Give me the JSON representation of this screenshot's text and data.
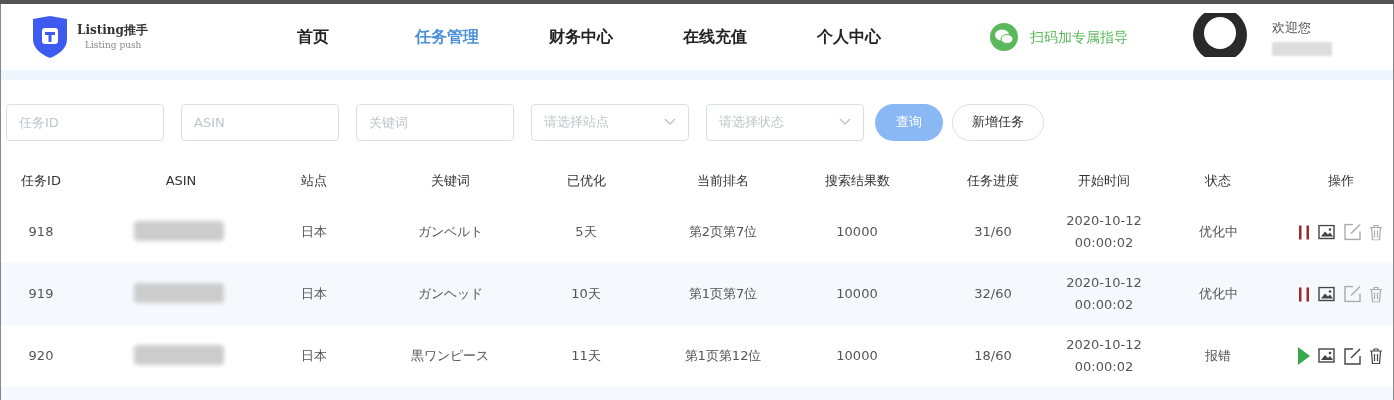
{
  "header": {
    "logo": {
      "title": "Listing推手",
      "subtitle": "Listing push"
    },
    "nav": [
      {
        "label": "首页",
        "selected": false
      },
      {
        "label": "任务管理",
        "selected": true
      },
      {
        "label": "财务中心",
        "selected": false
      },
      {
        "label": "在线充值",
        "selected": false
      },
      {
        "label": "个人中心",
        "selected": false
      }
    ],
    "wechat_link": "扫码加专属指导",
    "welcome": "欢迎您"
  },
  "filters": [
    {
      "kind": "input",
      "placeholder": "任务ID"
    },
    {
      "kind": "input",
      "placeholder": "ASIN"
    },
    {
      "kind": "input",
      "placeholder": "关键词"
    },
    {
      "kind": "select",
      "placeholder": "请选择站点"
    },
    {
      "kind": "select",
      "placeholder": "请选择状态"
    }
  ],
  "buttons": [
    {
      "kind": "primary",
      "label": "查询"
    },
    {
      "kind": "default",
      "label": "新增任务"
    }
  ],
  "table": {
    "columns": [
      "任务ID",
      "ASIN",
      "站点",
      "关键词",
      "已优化",
      "当前排名",
      "搜索结果数",
      "任务进度",
      "开始时间",
      "状态",
      "操作"
    ],
    "rows": [
      {
        "id": "918",
        "site": "日本",
        "keyword": "ガンベルト",
        "optimized": "5天",
        "rank": "第2页第7位",
        "results": "10000",
        "progress": "31/60",
        "date": "2020-10-12",
        "time": "00:00:02",
        "status": "优化中",
        "running": true,
        "editable": false
      },
      {
        "id": "919",
        "site": "日本",
        "keyword": "ガンヘッド",
        "optimized": "10天",
        "rank": "第1页第7位",
        "results": "10000",
        "progress": "32/60",
        "date": "2020-10-12",
        "time": "00:00:02",
        "status": "优化中",
        "running": true,
        "editable": false
      },
      {
        "id": "920",
        "site": "日本",
        "keyword": "黒ワンピース",
        "optimized": "11天",
        "rank": "第1页第12位",
        "results": "10000",
        "progress": "18/60",
        "date": "2020-10-12",
        "time": "00:00:02",
        "status": "报错",
        "running": false,
        "editable": true
      }
    ]
  }
}
